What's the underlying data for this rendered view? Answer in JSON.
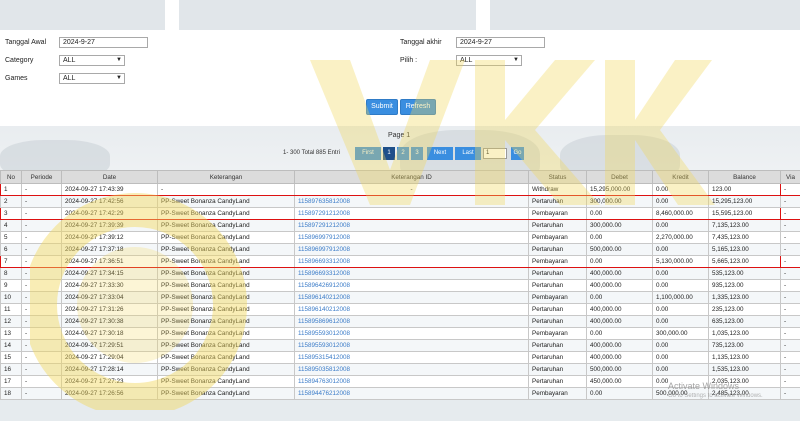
{
  "filters": {
    "tanggal_awal": {
      "label": "Tanggal Awal",
      "value": "2024-9-27"
    },
    "tanggal_akhir": {
      "label": "Tanggal akhir",
      "value": "2024-9-27"
    },
    "category": {
      "label": "Category",
      "value": "ALL"
    },
    "pilih": {
      "label": "Pilih :",
      "value": "ALL"
    },
    "games": {
      "label": "Games",
      "value": "ALL"
    },
    "submit_label": "Submit",
    "refresh_label": "Refresh"
  },
  "pagination": {
    "page_label": "Page 1",
    "total_text": "1- 300 Total 885 Entri",
    "first": "First",
    "pages": [
      "1",
      "2",
      "3"
    ],
    "next": "Next",
    "last": "Last",
    "input_value": "1",
    "go": "Go"
  },
  "table": {
    "headers": [
      "No",
      "Periode",
      "Date",
      "Keterangan",
      "Keterangan ID",
      "Status",
      "Debet",
      "Kredit",
      "Balance",
      "Via"
    ],
    "rows": [
      [
        "1",
        "-",
        "2024-09-27 17:43:39",
        "-",
        "-",
        "Withdraw",
        "15,295,000.00",
        "0.00",
        "123.00",
        "-"
      ],
      [
        "2",
        "-",
        "2024-09-27 17:42:56",
        "PP-Sweet Bonanza CandyLand",
        "115897635812008",
        "Pertaruhan",
        "300,000.00",
        "0.00",
        "15,295,123.00",
        "-"
      ],
      [
        "3",
        "-",
        "2024-09-27 17:42:29",
        "PP-Sweet Bonanza CandyLand",
        "115897291212008",
        "Pembayaran",
        "0.00",
        "8,460,000.00",
        "15,595,123.00",
        "-"
      ],
      [
        "4",
        "-",
        "2024-09-27 17:39:39",
        "PP-Sweet Bonanza CandyLand",
        "115897291212008",
        "Pertaruhan",
        "300,000.00",
        "0.00",
        "7,135,123.00",
        "-"
      ],
      [
        "5",
        "-",
        "2024-09-27 17:39:12",
        "PP-Sweet Bonanza CandyLand",
        "115896997912008",
        "Pembayaran",
        "0.00",
        "2,270,000.00",
        "7,435,123.00",
        "-"
      ],
      [
        "6",
        "-",
        "2024-09-27 17:37:18",
        "PP-Sweet Bonanza CandyLand",
        "115896997912008",
        "Pertaruhan",
        "500,000.00",
        "0.00",
        "5,165,123.00",
        "-"
      ],
      [
        "7",
        "-",
        "2024-09-27 17:36:51",
        "PP-Sweet Bonanza CandyLand",
        "115896693312008",
        "Pembayaran",
        "0.00",
        "5,130,000.00",
        "5,665,123.00",
        "-"
      ],
      [
        "8",
        "-",
        "2024-09-27 17:34:15",
        "PP-Sweet Bonanza CandyLand",
        "115896693312008",
        "Pertaruhan",
        "400,000.00",
        "0.00",
        "535,123.00",
        "-"
      ],
      [
        "9",
        "-",
        "2024-09-27 17:33:30",
        "PP-Sweet Bonanza CandyLand",
        "115896426912008",
        "Pertaruhan",
        "400,000.00",
        "0.00",
        "935,123.00",
        "-"
      ],
      [
        "10",
        "-",
        "2024-09-27 17:33:04",
        "PP-Sweet Bonanza CandyLand",
        "115896140212008",
        "Pembayaran",
        "0.00",
        "1,100,000.00",
        "1,335,123.00",
        "-"
      ],
      [
        "11",
        "-",
        "2024-09-27 17:31:26",
        "PP-Sweet Bonanza CandyLand",
        "115896140212008",
        "Pertaruhan",
        "400,000.00",
        "0.00",
        "235,123.00",
        "-"
      ],
      [
        "12",
        "-",
        "2024-09-27 17:30:38",
        "PP-Sweet Bonanza CandyLand",
        "115895869612008",
        "Pertaruhan",
        "400,000.00",
        "0.00",
        "635,123.00",
        "-"
      ],
      [
        "13",
        "-",
        "2024-09-27 17:30:18",
        "PP-Sweet Bonanza CandyLand",
        "115895593012008",
        "Pembayaran",
        "0.00",
        "300,000.00",
        "1,035,123.00",
        "-"
      ],
      [
        "14",
        "-",
        "2024-09-27 17:29:51",
        "PP-Sweet Bonanza CandyLand",
        "115895593012008",
        "Pertaruhan",
        "400,000.00",
        "0.00",
        "735,123.00",
        "-"
      ],
      [
        "15",
        "-",
        "2024-09-27 17:29:04",
        "PP-Sweet Bonanza CandyLand",
        "115895315412008",
        "Pertaruhan",
        "400,000.00",
        "0.00",
        "1,135,123.00",
        "-"
      ],
      [
        "16",
        "-",
        "2024-09-27 17:28:14",
        "PP-Sweet Bonanza CandyLand",
        "115895035812008",
        "Pertaruhan",
        "500,000.00",
        "0.00",
        "1,535,123.00",
        "-"
      ],
      [
        "17",
        "-",
        "2024-09-27 17:27:23",
        "PP-Sweet Bonanza CandyLand",
        "115894763012008",
        "Pertaruhan",
        "450,000.00",
        "0.00",
        "2,035,123.00",
        "-"
      ],
      [
        "18",
        "-",
        "2024-09-27 17:26:56",
        "PP-Sweet Bonanza CandyLand",
        "115894476212008",
        "Pembayaran",
        "0.00",
        "500,000.00",
        "2,485,123.00",
        "-"
      ]
    ],
    "highlighted_rows": [
      0,
      2,
      6
    ]
  },
  "windows_overlay": {
    "line1": "Activate Windows",
    "line2": "Go to Settings to activate Windows."
  },
  "colors": {
    "accent": "#3a8ee0",
    "highlight": "#dd1111",
    "link": "#3a7bc8"
  }
}
